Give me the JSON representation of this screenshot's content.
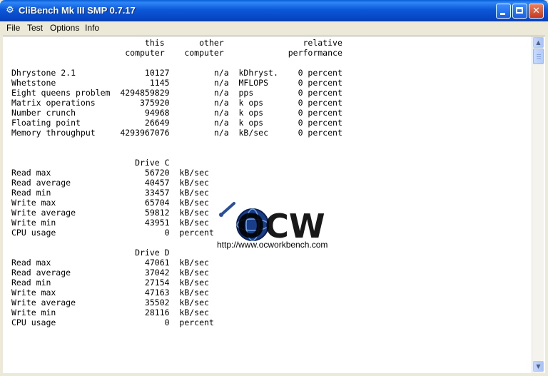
{
  "window": {
    "title": "CliBench Mk III SMP 0.7.17"
  },
  "menu": [
    "File",
    "Test",
    "Options",
    "Info"
  ],
  "report": {
    "lines": [
      "                           this       other                relative",
      "                       computer    computer             performance",
      "",
      "Dhrystone 2.1              10127         n/a  kDhryst.    0 percent",
      "Whetstone                   1145         n/a  MFLOPS      0 percent",
      "Eight queens problem  4294859829         n/a  pps         0 percent",
      "Matrix operations         375920         n/a  k ops       0 percent",
      "Number crunch              94968         n/a  k ops       0 percent",
      "Floating point             26649         n/a  k ops       0 percent",
      "Memory throughput     4293967076         n/a  kB/sec      0 percent",
      "",
      "",
      "                         Drive C",
      "Read max                   56720  kB/sec",
      "Read average               40457  kB/sec",
      "Read min                   33457  kB/sec",
      "Write max                  65704  kB/sec",
      "Write average              59812  kB/sec",
      "Write min                  43951  kB/sec",
      "CPU usage                      0  percent",
      "",
      "                         Drive D",
      "Read max                   47061  kB/sec",
      "Read average               37042  kB/sec",
      "Read min                   27154  kB/sec",
      "Write max                  47163  kB/sec",
      "Write average              35502  kB/sec",
      "Write min                  28116  kB/sec",
      "CPU usage                      0  percent"
    ]
  },
  "watermark": {
    "logo": "OCW",
    "url": "http://www.ocworkbench.com"
  },
  "colors": {
    "titlebar": "#0a5fd8",
    "close": "#d24a2a",
    "logo_text": "#000000",
    "logo_globe": "#1a3d8a"
  }
}
